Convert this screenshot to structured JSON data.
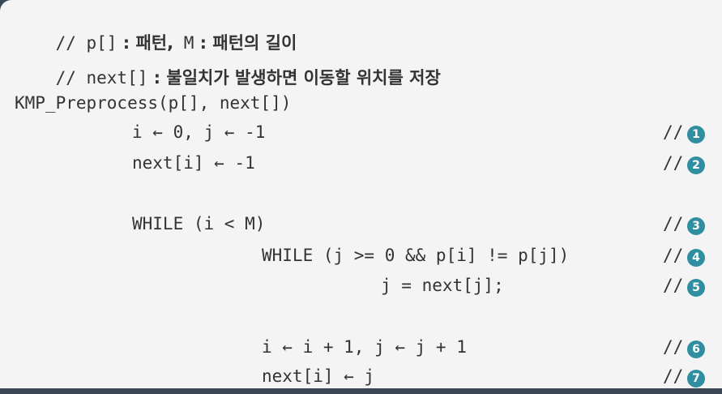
{
  "header": {
    "line1_code_a": "// p[]",
    "line1_ko_a": " : 패턴,",
    "line1_code_b": " M",
    "line1_ko_b": " : 패턴의 길이",
    "line2_code_a": "// next[]",
    "line2_ko_a": " : 불일치가 발생하면 이동할 위치를 저장"
  },
  "code": {
    "signature": "KMP_Preprocess(p[], next[])",
    "l1": "i ← 0, j ← -1",
    "l2": "next[i] ← -1",
    "l3": "WHILE (i < M)",
    "l4": "WHILE (j >= 0 && p[i] != p[j])",
    "l5": "j = next[j];",
    "l6": "i ← i + 1, j ← j + 1",
    "l7": "next[i] ← j"
  },
  "comments": {
    "prefix": "//",
    "n1": "1",
    "n2": "2",
    "n3": "3",
    "n4": "4",
    "n5": "5",
    "n6": "6",
    "n7": "7"
  },
  "colors": {
    "badge": "#2f8fa0",
    "text": "#333333",
    "background": "#f4f4f4"
  }
}
